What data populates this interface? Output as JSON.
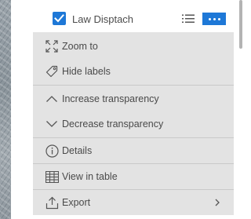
{
  "layer": {
    "name": "Law Disptach",
    "checked": true,
    "accent_color": "#1e78d7"
  },
  "menu": {
    "items": [
      {
        "label": "Zoom to",
        "icon": "zoom-to-icon"
      },
      {
        "label": "Hide labels",
        "icon": "label-tag-icon"
      },
      {
        "label": "Increase transparency",
        "icon": "chevron-up-icon"
      },
      {
        "label": "Decrease transparency",
        "icon": "chevron-down-icon"
      },
      {
        "label": "Details",
        "icon": "info-icon"
      },
      {
        "label": "View in table",
        "icon": "table-icon"
      },
      {
        "label": "Export",
        "icon": "export-icon",
        "has_submenu": true
      }
    ]
  }
}
